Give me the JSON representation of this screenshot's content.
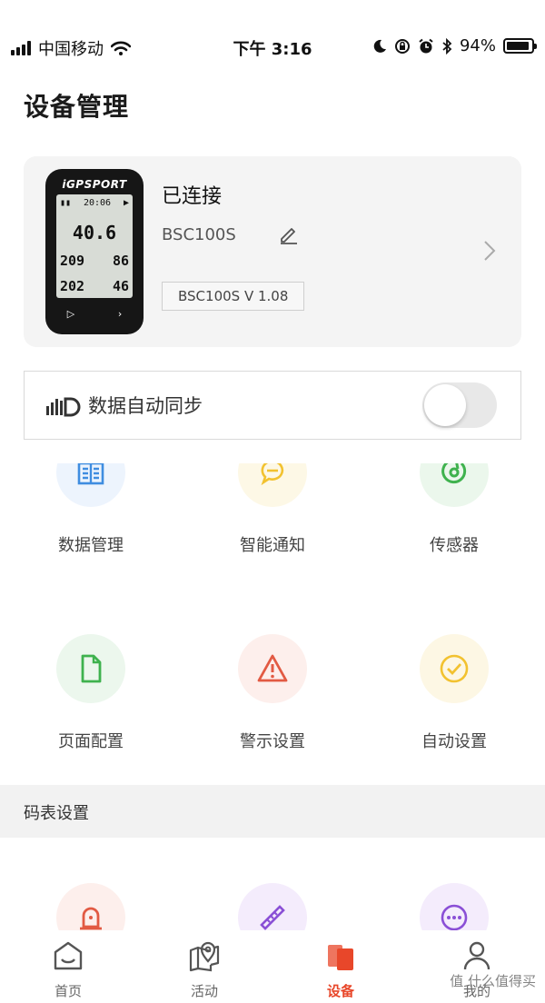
{
  "status_bar": {
    "carrier": "中国移动",
    "time": "下午 3:16",
    "battery_percent": "94%",
    "battery_level": 0.94,
    "icons": [
      "signal-icon",
      "wifi-icon",
      "moon-icon",
      "rotation-lock-icon",
      "alarm-icon",
      "bluetooth-icon",
      "battery-icon"
    ]
  },
  "page": {
    "title": "设备管理"
  },
  "device": {
    "status": "已连接",
    "model": "BSC100S",
    "version": "BSC100S V 1.08",
    "image": {
      "brand": "iGPSPORT",
      "time": "20:06",
      "speed": "40.6",
      "row1_left": "209",
      "row1_right": "86",
      "row2_left": "202",
      "row2_right": "46"
    }
  },
  "sync": {
    "label": "数据自动同步",
    "enabled": false
  },
  "features": [
    {
      "label": "数据管理",
      "icon": "data-management-icon"
    },
    {
      "label": "智能通知",
      "icon": "smart-notification-icon"
    },
    {
      "label": "传感器",
      "icon": "sensor-icon"
    },
    {
      "label": "页面配置",
      "icon": "page-config-icon"
    },
    {
      "label": "警示设置",
      "icon": "warning-icon"
    },
    {
      "label": "自动设置",
      "icon": "auto-settings-icon"
    }
  ],
  "section": {
    "title": "码表设置"
  },
  "tabs": [
    {
      "label": "首页",
      "icon": "home-icon"
    },
    {
      "label": "活动",
      "icon": "activity-map-icon"
    },
    {
      "label": "设备",
      "icon": "device-icon",
      "active": true
    },
    {
      "label": "我的",
      "icon": "profile-icon"
    }
  ],
  "watermark": "值 什么值得买",
  "colors": {
    "accent": "#e8472a",
    "blue": "#3f8de0",
    "yellow": "#f2c230",
    "green": "#3fb24e",
    "red": "#e25a43",
    "purple": "#8a4fd6"
  }
}
